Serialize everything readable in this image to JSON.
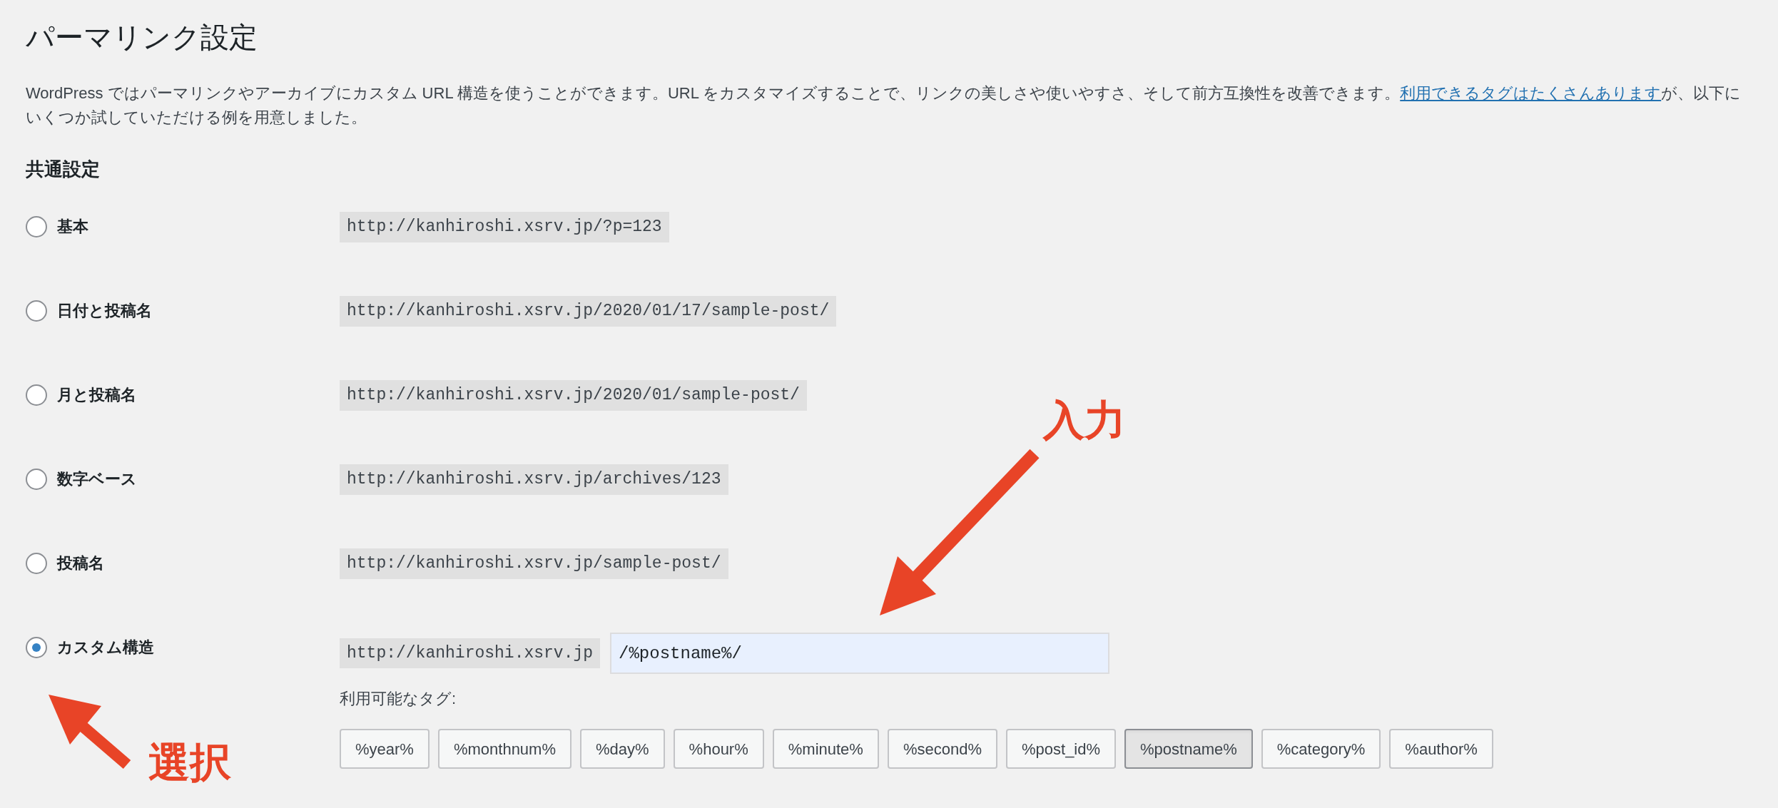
{
  "title": "パーマリンク設定",
  "intro": {
    "text": "WordPress ではパーマリンクやアーカイブにカスタム URL 構造を使うことができます。URL をカスタマイズすることで、リンクの美しさや使いやすさ、そして前方互換性を改善できます。",
    "link": "利用できるタグはたくさんあります",
    "after": "が、以下にいくつか試していただける例を用意しました。"
  },
  "section_title": "共通設定",
  "options": [
    {
      "label": "基本",
      "selected": false,
      "kind": "example",
      "url": "http://kanhiroshi.xsrv.jp/?p=123"
    },
    {
      "label": "日付と投稿名",
      "selected": false,
      "kind": "example",
      "url": "http://kanhiroshi.xsrv.jp/2020/01/17/sample-post/"
    },
    {
      "label": "月と投稿名",
      "selected": false,
      "kind": "example",
      "url": "http://kanhiroshi.xsrv.jp/2020/01/sample-post/"
    },
    {
      "label": "数字ベース",
      "selected": false,
      "kind": "example",
      "url": "http://kanhiroshi.xsrv.jp/archives/123"
    },
    {
      "label": "投稿名",
      "selected": false,
      "kind": "example",
      "url": "http://kanhiroshi.xsrv.jp/sample-post/"
    },
    {
      "label": "カスタム構造",
      "selected": true,
      "kind": "custom",
      "url": "http://kanhiroshi.xsrv.jp",
      "value": "/%postname%/"
    }
  ],
  "tags_label": "利用可能なタグ:",
  "tags": [
    {
      "label": "%year%",
      "selected": false
    },
    {
      "label": "%monthnum%",
      "selected": false
    },
    {
      "label": "%day%",
      "selected": false
    },
    {
      "label": "%hour%",
      "selected": false
    },
    {
      "label": "%minute%",
      "selected": false
    },
    {
      "label": "%second%",
      "selected": false
    },
    {
      "label": "%post_id%",
      "selected": false
    },
    {
      "label": "%postname%",
      "selected": true
    },
    {
      "label": "%category%",
      "selected": false
    },
    {
      "label": "%author%",
      "selected": false
    }
  ],
  "annotations": [
    {
      "text": "入力"
    },
    {
      "text": "選択"
    }
  ]
}
